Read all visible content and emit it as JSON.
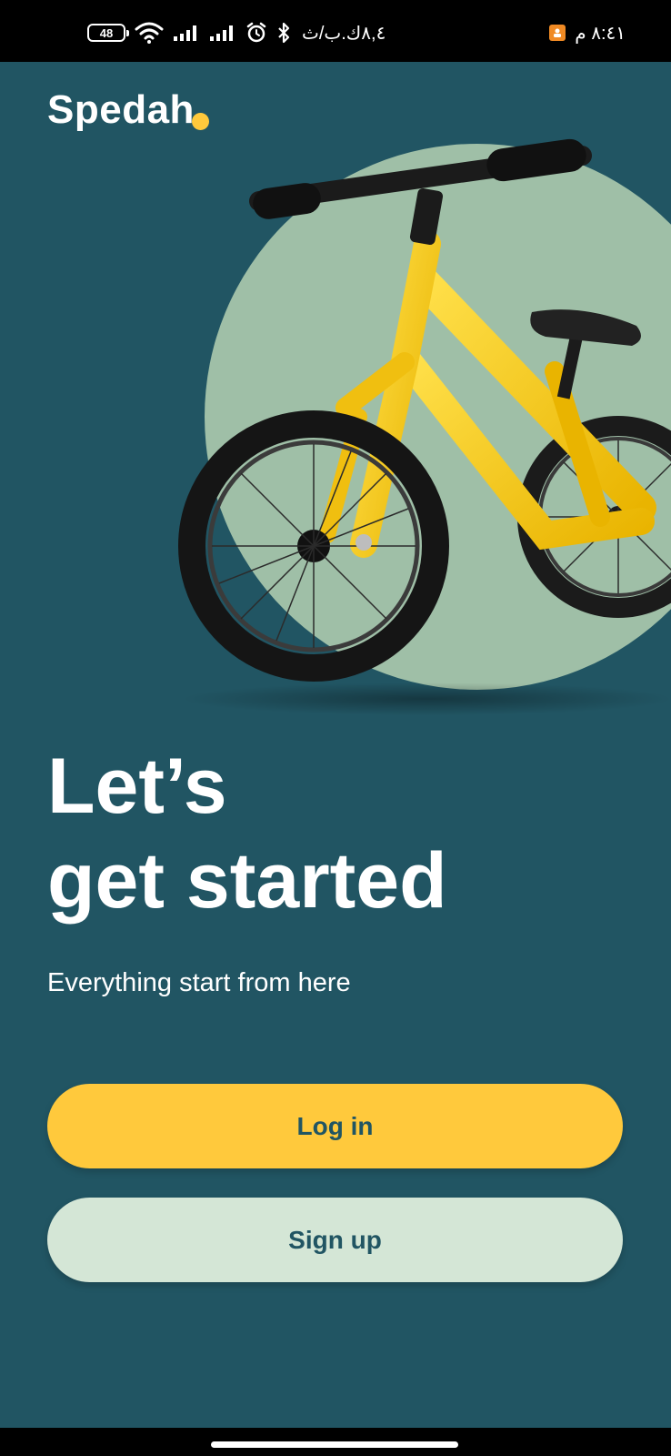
{
  "status_bar": {
    "battery_level": "48",
    "left_time": "٨,٤ك.ب/ث",
    "right_time": "٨:٤١ م",
    "icons": [
      "battery-icon",
      "wifi-icon",
      "signal-icon",
      "signal-icon-2",
      "alarm-icon",
      "bluetooth-icon",
      "notification-icon"
    ]
  },
  "brand": {
    "name": "Spedah",
    "accent_color": "#ffc93c"
  },
  "hero": {
    "image": "balance-bike-illustration",
    "circle_color": "#9fbfa7",
    "bike_color": "#f5c81a"
  },
  "headline": {
    "line1": "Let’s",
    "line2": "get started"
  },
  "subtitle": "Everything start from here",
  "buttons": {
    "login": "Log in",
    "signup": "Sign up"
  },
  "colors": {
    "background": "#215563",
    "primary_button": "#ffc93c",
    "secondary_button": "#d4e6d6",
    "button_text": "#215563"
  }
}
